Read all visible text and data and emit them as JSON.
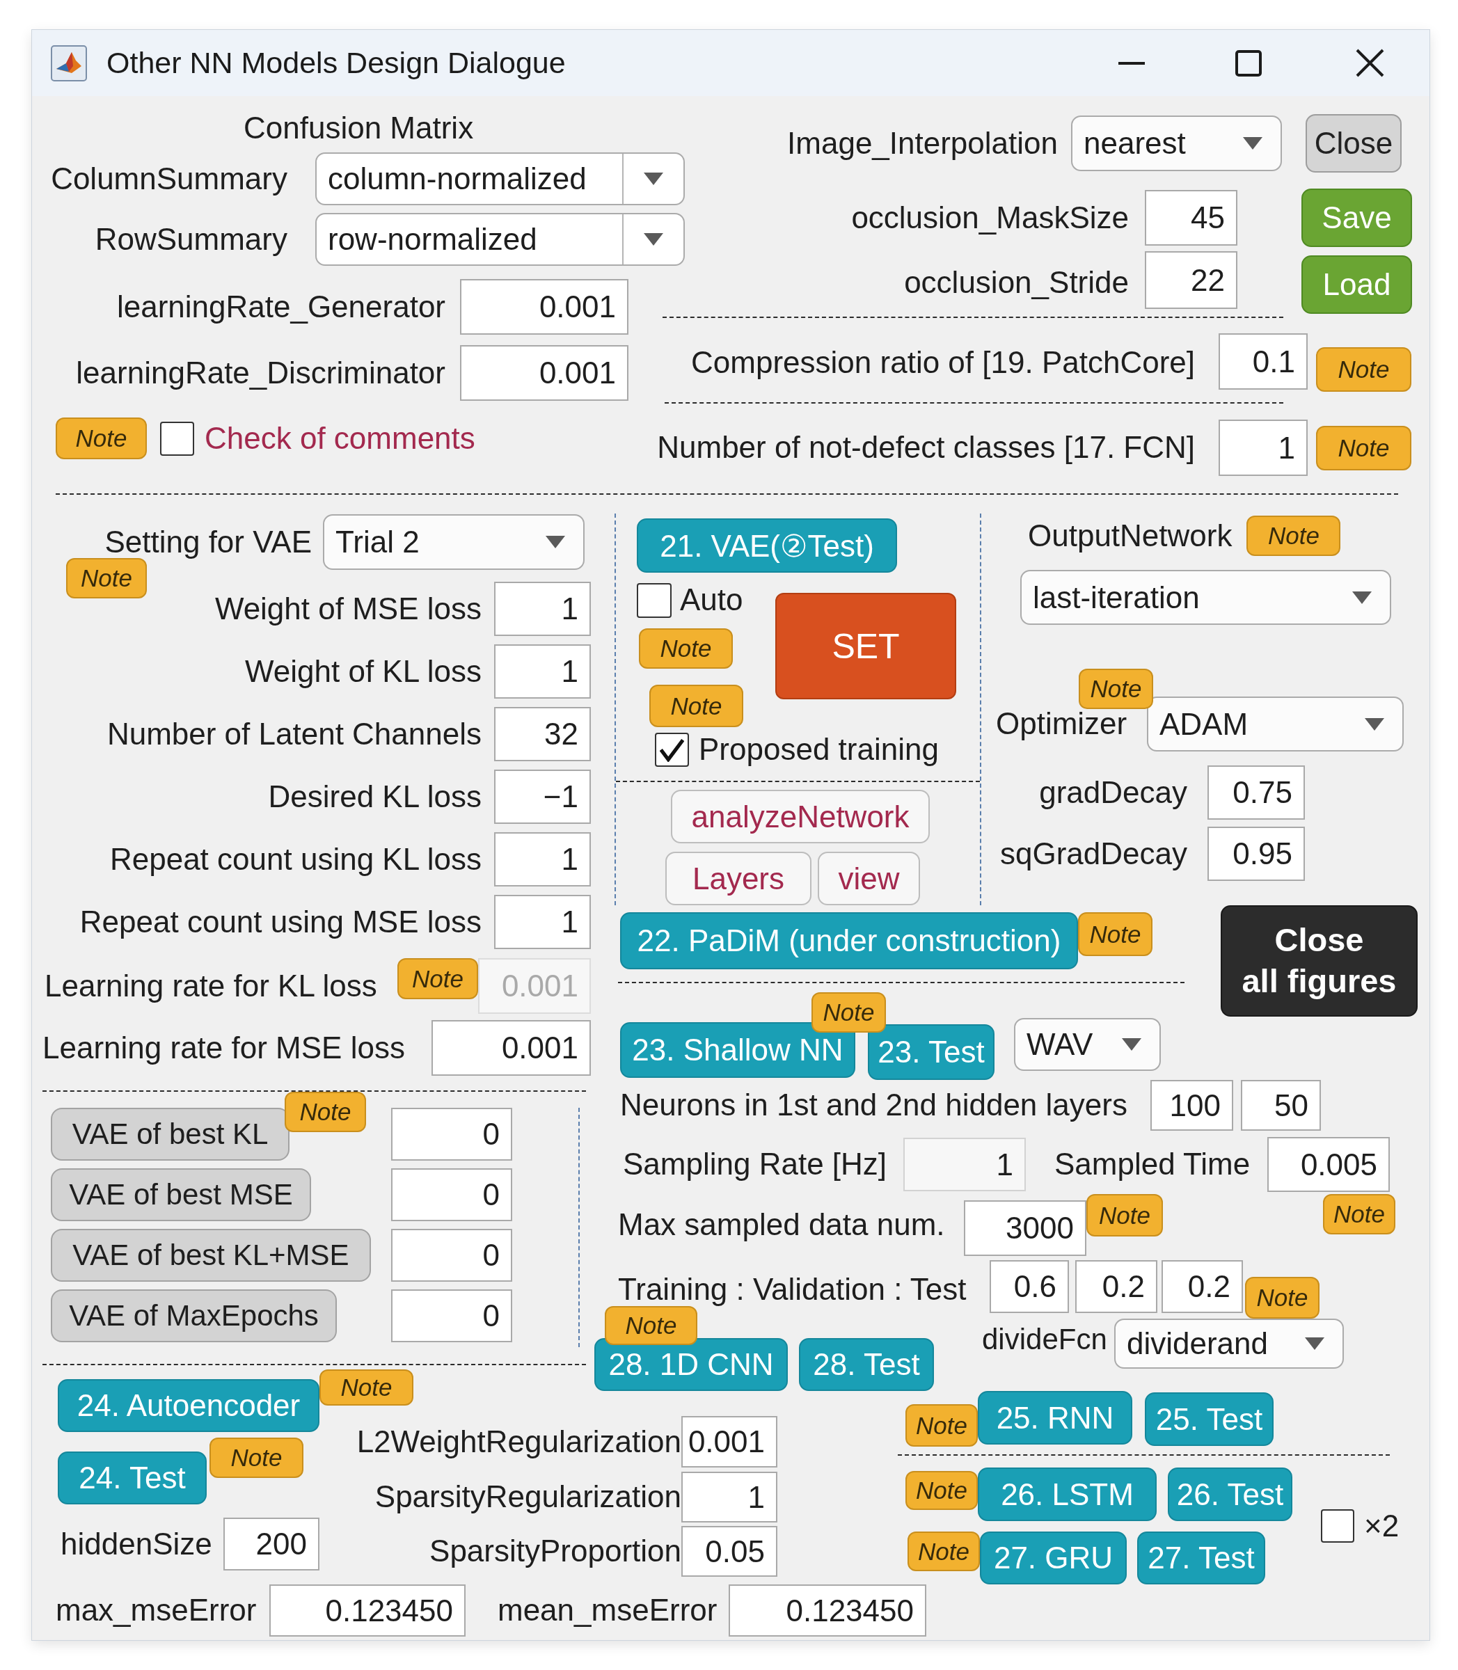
{
  "window": {
    "title": "Other NN Models Design Dialogue"
  },
  "confusion_matrix": {
    "title": "Confusion Matrix",
    "summaries": [
      {
        "label": "ColumnSummary",
        "value": "column-normalized"
      },
      {
        "label": "RowSummary",
        "value": "row-normalized"
      }
    ]
  },
  "learning_rates": [
    {
      "label": "learningRate_Generator",
      "value": "0.001"
    },
    {
      "label": "learningRate_Discriminator",
      "value": "0.001"
    }
  ],
  "comments": {
    "note": "Note",
    "label": "Check of comments",
    "checked": false
  },
  "image_interpolation": {
    "label": "Image_Interpolation",
    "value": "nearest"
  },
  "occlusion": [
    {
      "label": "occlusion_MaskSize",
      "value": "45"
    },
    {
      "label": "occlusion_Stride",
      "value": "22"
    }
  ],
  "file_buttons": [
    {
      "label": "Close",
      "kind": "neutral"
    },
    {
      "label": "Save",
      "kind": "action"
    },
    {
      "label": "Load",
      "kind": "action"
    }
  ],
  "patchcore": {
    "label": "Compression ratio of [19. PatchCore]",
    "value": "0.1",
    "note": "Note"
  },
  "fcn": {
    "label": "Number of not-defect classes [17. FCN]",
    "value": "1",
    "note": "Note"
  },
  "vae_settings": {
    "label": "Setting for VAE",
    "value": "Trial 2",
    "note": "Note",
    "fields": [
      {
        "label": "Weight of MSE loss",
        "value": "1"
      },
      {
        "label": "Weight of KL loss",
        "value": "1"
      },
      {
        "label": "Number of Latent Channels",
        "value": "32"
      },
      {
        "label": "Desired KL loss",
        "value": "−1"
      },
      {
        "label": "Repeat count using KL loss",
        "value": "1"
      },
      {
        "label": "Repeat count using MSE loss",
        "value": "1"
      }
    ],
    "rates": [
      {
        "label": "Learning rate for KL loss",
        "note": "Note",
        "value": "0.001",
        "disabled": true
      },
      {
        "label": "Learning rate for MSE loss",
        "value": "0.001",
        "disabled": false
      }
    ]
  },
  "vae_best": {
    "note": "Note",
    "rows": [
      {
        "label": "VAE of best KL",
        "value": "0"
      },
      {
        "label": "VAE of best MSE",
        "value": "0"
      },
      {
        "label": "VAE of best KL+MSE",
        "value": "0"
      },
      {
        "label": "VAE of MaxEpochs",
        "value": "0"
      }
    ]
  },
  "autoencoder": {
    "buttons": [
      {
        "label": "24. Autoencoder",
        "note": "Note"
      },
      {
        "label": "24. Test",
        "note": "Note"
      }
    ],
    "hidden_size": {
      "label": "hiddenSize",
      "value": "200"
    },
    "params": [
      {
        "label": "L2WeightRegularization",
        "value": "0.001"
      },
      {
        "label": "SparsityRegularization",
        "value": "1"
      },
      {
        "label": "SparsityProportion",
        "value": "0.05"
      }
    ],
    "errors": [
      {
        "label": "max_mseError",
        "value": "0.123450"
      },
      {
        "label": "mean_mseError",
        "value": "0.123450"
      }
    ]
  },
  "vae_test": {
    "button": "21. VAE(②Test)",
    "auto": {
      "label": "Auto",
      "checked": false
    },
    "notes": [
      "Note",
      "Note"
    ],
    "set_button": "SET",
    "proposed": {
      "label": "Proposed training",
      "checked": true
    },
    "tools": [
      "analyzeNetwork",
      "Layers",
      "view"
    ]
  },
  "output_network": {
    "label": "OutputNetwork",
    "note": "Note",
    "value": "last-iteration"
  },
  "optimizer": {
    "label": "Optimizer",
    "note": "Note",
    "value": "ADAM",
    "params": [
      {
        "label": "gradDecay",
        "value": "0.75"
      },
      {
        "label": "sqGradDecay",
        "value": "0.95"
      }
    ]
  },
  "padim": {
    "button": "22. PaDiM (under construction)",
    "note": "Note"
  },
  "close_all_button": "Close\nall figures",
  "shallow_nn": {
    "note": "Note",
    "buttons": [
      "23. Shallow NN",
      "23. Test"
    ],
    "data_type": "WAV",
    "neurons": {
      "label": "Neurons in 1st and 2nd hidden layers",
      "values": [
        "100",
        "50"
      ]
    },
    "sampling_rate": {
      "label": "Sampling Rate [Hz]",
      "value": "1",
      "readonly": true
    },
    "sampled_time": {
      "label": "Sampled Time",
      "value": "0.005",
      "note": "Note"
    },
    "max_data": {
      "label": "Max sampled data num.",
      "value": "3000",
      "note": "Note"
    },
    "split": {
      "label": "Training : Validation : Test",
      "values": [
        "0.6",
        "0.2",
        "0.2"
      ],
      "note": "Note"
    },
    "divide_fcn": {
      "label": "divideFcn",
      "value": "dividerand"
    }
  },
  "cnn_1d": {
    "note": "Note",
    "buttons": [
      "28. 1D CNN",
      "28. Test"
    ]
  },
  "recurrent": {
    "rows": [
      {
        "note": "Note",
        "buttons": [
          "25. RNN",
          "25. Test"
        ]
      },
      {
        "note": "Note",
        "buttons": [
          "26. LSTM",
          "26. Test"
        ]
      },
      {
        "note": "Note",
        "buttons": [
          "27. GRU",
          "27. Test"
        ]
      }
    ],
    "double": {
      "label": "×2",
      "checked": false
    }
  }
}
